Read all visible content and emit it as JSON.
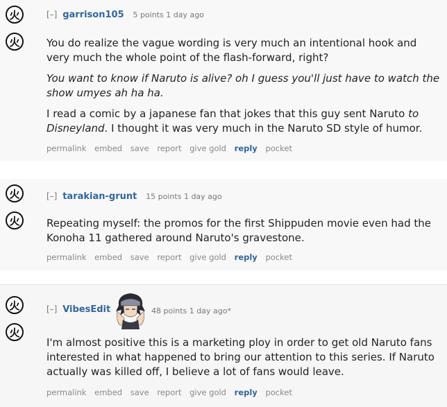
{
  "vote_glyph": "火",
  "comments": [
    {
      "toggle": "[–]",
      "author": "garrison105",
      "meta": "5 points 1 day ago",
      "paragraphs": [
        "You do realize the vague wording is very much an intentional hook and very much the whole point of the flash-forward, right?",
        "You want to know if Naruto is alive? oh I guess you'll just have to watch the show umyes ah ha ha."
      ],
      "p3_before": "I read a comic by a japanese fan that jokes that this guy sent Naruto ",
      "p3_italic": "to Disneyland",
      "p3_after": ". I thought it was very much in the Naruto SD style of humor."
    },
    {
      "toggle": "[–]",
      "author": "tarakian-grunt",
      "meta": "15 points 1 day ago",
      "paragraphs": [
        "Repeating myself: the promos for the first Shippuden movie even had the Konoha 11 gathered around Naruto's gravestone."
      ]
    },
    {
      "toggle": "[–]",
      "author": "VibesEdit",
      "meta": "48 points 1 day ago*",
      "paragraphs": [
        "I'm almost positive this is a marketing ploy in order to get old Naruto fans interested in what happened to bring our attention to this series. If Naruto actually was killed off, I believe a lot of fans would leave."
      ]
    }
  ],
  "buttons": {
    "permalink": "permalink",
    "embed": "embed",
    "save": "save",
    "report": "report",
    "give_gold": "give gold",
    "reply": "reply",
    "pocket": "pocket"
  }
}
